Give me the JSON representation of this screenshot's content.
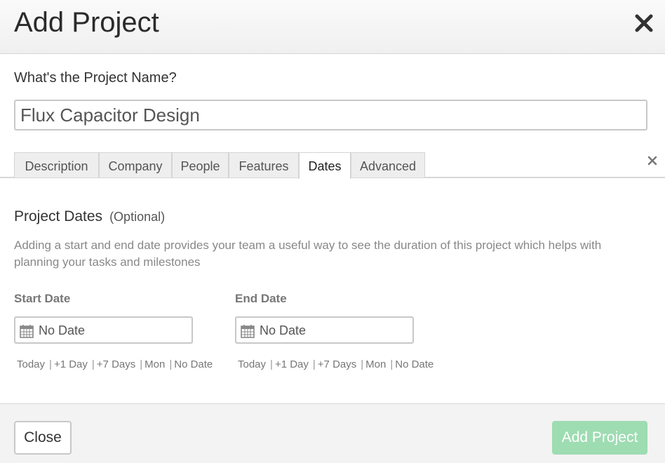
{
  "dialog": {
    "title": "Add Project",
    "close_icon": "close-x-icon"
  },
  "project_name": {
    "label": "What's the Project Name?",
    "value": "Flux Capacitor Design"
  },
  "tabs": [
    {
      "label": "Description",
      "active": false
    },
    {
      "label": "Company",
      "active": false
    },
    {
      "label": "People",
      "active": false
    },
    {
      "label": "Features",
      "active": false
    },
    {
      "label": "Dates",
      "active": true
    },
    {
      "label": "Advanced",
      "active": false
    }
  ],
  "dates_section": {
    "title": "Project Dates",
    "optional": "(Optional)",
    "description": "Adding a start and end date provides your team a useful way to see the duration of this project which helps with planning your tasks and milestones",
    "start": {
      "label": "Start Date",
      "value": "No Date",
      "icon": "calendar-icon",
      "quick_links": [
        "Today",
        "+1 Day",
        "+7 Days",
        "Mon",
        "No Date"
      ]
    },
    "end": {
      "label": "End Date",
      "value": "No Date",
      "icon": "calendar-icon",
      "quick_links": [
        "Today",
        "+1 Day",
        "+7 Days",
        "Mon",
        "No Date"
      ]
    }
  },
  "footer": {
    "close_label": "Close",
    "submit_label": "Add Project",
    "submit_color": "#9edcb2"
  }
}
